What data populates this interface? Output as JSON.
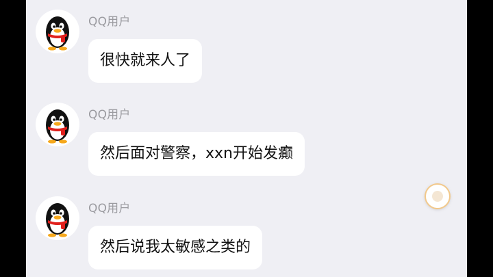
{
  "messages": [
    {
      "sender": "QQ用户",
      "text": "很快就来人了"
    },
    {
      "sender": "QQ用户",
      "text": "然后面对警察，xxn开始发癫"
    },
    {
      "sender": "QQ用户",
      "text": "然后说我太敏感之类的"
    }
  ],
  "icons": {
    "avatar": "qq-penguin-icon",
    "floating_button": "assistive-touch-icon"
  },
  "colors": {
    "background": "#efeff4",
    "bubble": "#ffffff",
    "sender": "#9b9ba0",
    "scarf": "#e0201c",
    "beak": "#f6a81c"
  }
}
